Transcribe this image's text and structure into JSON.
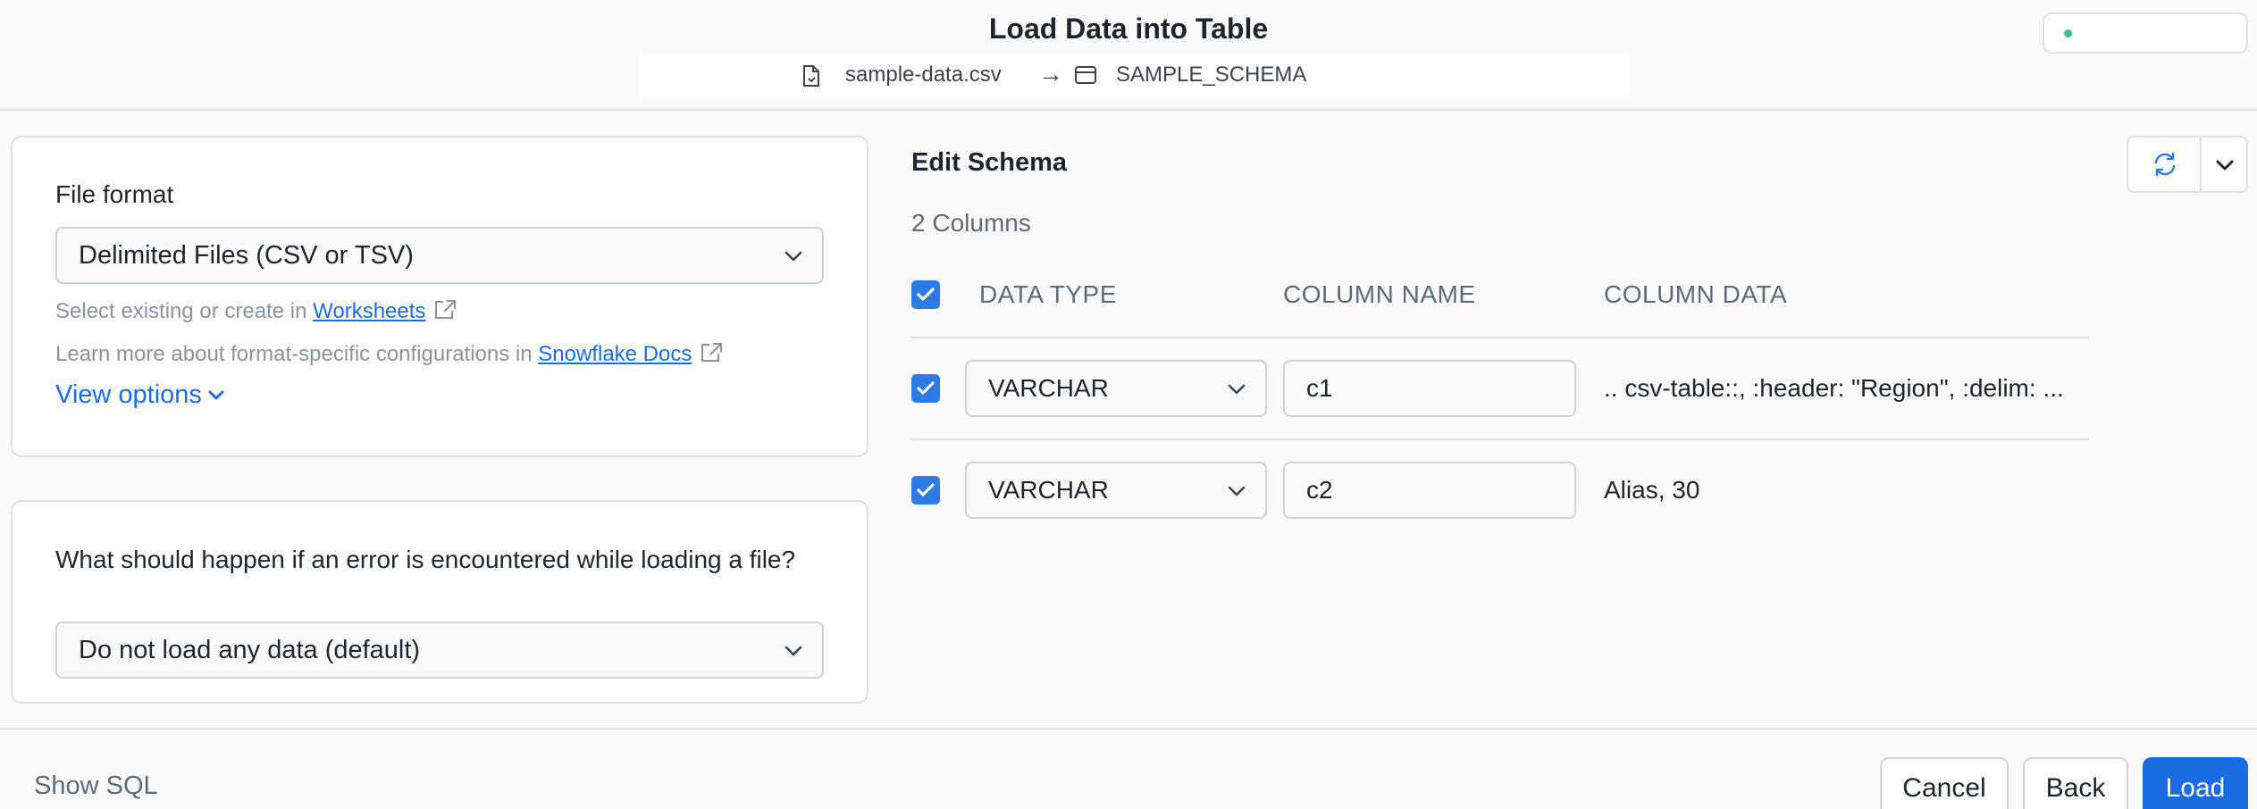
{
  "header": {
    "title": "Load Data into Table",
    "file_name": "sample-data.csv",
    "arrow": "→",
    "schema_name": "SAMPLE_SCHEMA",
    "status_color": "#3fbf86"
  },
  "file_format": {
    "label": "File format",
    "selected": "Delimited Files (CSV or TSV)",
    "hint1_prefix": "Select existing or create in ",
    "hint1_link": "Worksheets",
    "hint2_prefix": "Learn more about format-specific configurations in ",
    "hint2_link": "Snowflake Docs",
    "view_options": "View options"
  },
  "error_handling": {
    "label": "What should happen if an error is encountered while loading a file?",
    "selected": "Do not load any data (default)"
  },
  "schema": {
    "title": "Edit Schema",
    "count": "2 Columns",
    "headers": {
      "data_type": "DATA TYPE",
      "column_name": "COLUMN NAME",
      "column_data": "COLUMN DATA"
    },
    "rows": [
      {
        "type": "VARCHAR",
        "name": "c1",
        "data": ".. csv-table::, :header: \"Region\", :delim: ..."
      },
      {
        "type": "VARCHAR",
        "name": "c2",
        "data": "Alias, 30"
      }
    ]
  },
  "footer": {
    "show_sql": "Show SQL",
    "cancel": "Cancel",
    "back": "Back",
    "load": "Load"
  },
  "colors": {
    "accent": "#1a6ce3",
    "checkbox": "#2f7be6"
  }
}
